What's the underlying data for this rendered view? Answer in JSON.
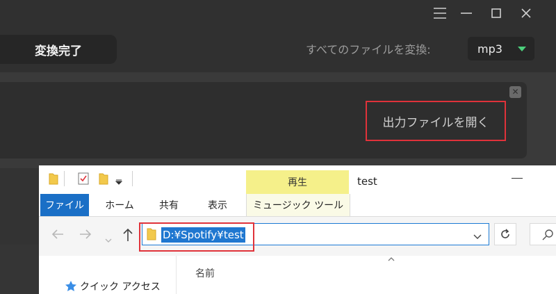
{
  "app": {
    "done_label": "変換完了",
    "convert_all_label": "すべてのファイルを変換:",
    "format": "mp3",
    "open_output_label": "出力ファイルを開く",
    "accent_green": "#4cd07c",
    "highlight_red": "#e0323a"
  },
  "explorer": {
    "title": "test",
    "context_group": "再生",
    "context_tab": "ミュージック ツール",
    "tabs": [
      "ファイル",
      "ホーム",
      "共有",
      "表示"
    ],
    "address": "D:¥Spotify¥test",
    "column_name": "名前",
    "quick_access": "クイック アクセス",
    "accent_blue": "#1a6fc6"
  }
}
